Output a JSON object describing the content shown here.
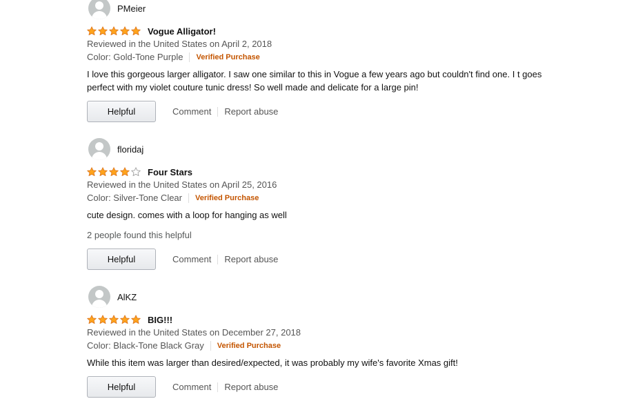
{
  "reviews": [
    {
      "author": "PMeier",
      "rating": 5,
      "title": "Vogue Alligator!",
      "date_line": "Reviewed in the United States on April 2, 2018",
      "color": "Color: Gold-Tone Purple",
      "verified": "Verified Purchase",
      "body": "I love this gorgeous larger alligator. I saw one similar to this in Vogue a few years ago but couldn't find one. I t goes perfect with my violet couture tunic dress! So well made and delicate for a large pin!",
      "helpful_count": "",
      "helpful_label": "Helpful",
      "comment_label": "Comment",
      "report_label": "Report abuse"
    },
    {
      "author": "floridaj",
      "rating": 4,
      "title": "Four Stars",
      "date_line": "Reviewed in the United States on April 25, 2016",
      "color": "Color: Silver-Tone Clear",
      "verified": "Verified Purchase",
      "body": "cute design. comes with a loop for hanging as well",
      "helpful_count": "2 people found this helpful",
      "helpful_label": "Helpful",
      "comment_label": "Comment",
      "report_label": "Report abuse"
    },
    {
      "author": "AlKZ",
      "rating": 5,
      "title": "BIG!!!",
      "date_line": "Reviewed in the United States on December 27, 2018",
      "color": "Color: Black-Tone Black Gray",
      "verified": "Verified Purchase",
      "body": "While this item was larger than desired/expected, it was probably my wife's favorite Xmas gift!",
      "helpful_count": "",
      "helpful_label": "Helpful",
      "comment_label": "Comment",
      "report_label": "Report abuse"
    }
  ],
  "colors": {
    "star_fill": "#ffa41c",
    "star_stroke": "#de7921",
    "verified": "#c45500"
  }
}
